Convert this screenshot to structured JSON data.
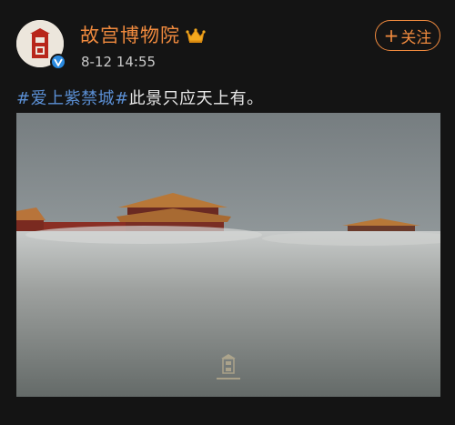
{
  "account": {
    "name": "故宫博物院",
    "time": "8-12 14:55",
    "follow_label": "关注",
    "follow_icon": "plus-icon",
    "avatar_icon": "palace-logo-icon",
    "badge_icon": "crown-icon",
    "verified_icon": "verified-v-icon"
  },
  "post": {
    "hashtag": "#爱上紫禁城#",
    "text": "此景只应天上有。"
  },
  "colors": {
    "background": "#141414",
    "accent": "#f08a3e",
    "hashtag": "#5b8fd4",
    "verified": "#2a8ae0"
  }
}
